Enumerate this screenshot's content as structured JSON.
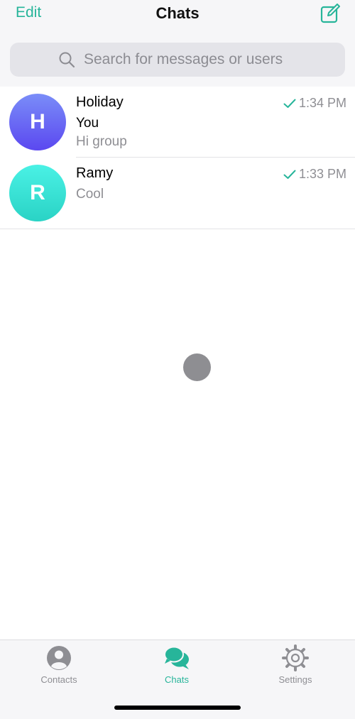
{
  "header": {
    "edit_label": "Edit",
    "title": "Chats",
    "compose_icon": "compose-icon"
  },
  "search": {
    "placeholder": "Search for messages or users",
    "value": ""
  },
  "chats": [
    {
      "initial": "H",
      "name": "Holiday",
      "time": "1:34 PM",
      "sender": "You",
      "preview": "Hi group",
      "status": "sent-check",
      "avatar_colors": [
        "#7a8df8",
        "#5b48f0"
      ]
    },
    {
      "initial": "R",
      "name": "Ramy",
      "time": "1:33 PM",
      "preview": "Cool",
      "status": "sent-check",
      "avatar_colors": [
        "#4af1e5",
        "#2ad3c5"
      ]
    }
  ],
  "tabs": [
    {
      "label": "Contacts",
      "icon": "person-circle-icon",
      "active": false
    },
    {
      "label": "Chats",
      "icon": "chat-bubbles-icon",
      "active": true
    },
    {
      "label": "Settings",
      "icon": "gear-icon",
      "active": false
    }
  ],
  "colors": {
    "accent": "#27b59a",
    "secondary_text": "#8e8e93",
    "header_bg": "#f6f6f8"
  }
}
